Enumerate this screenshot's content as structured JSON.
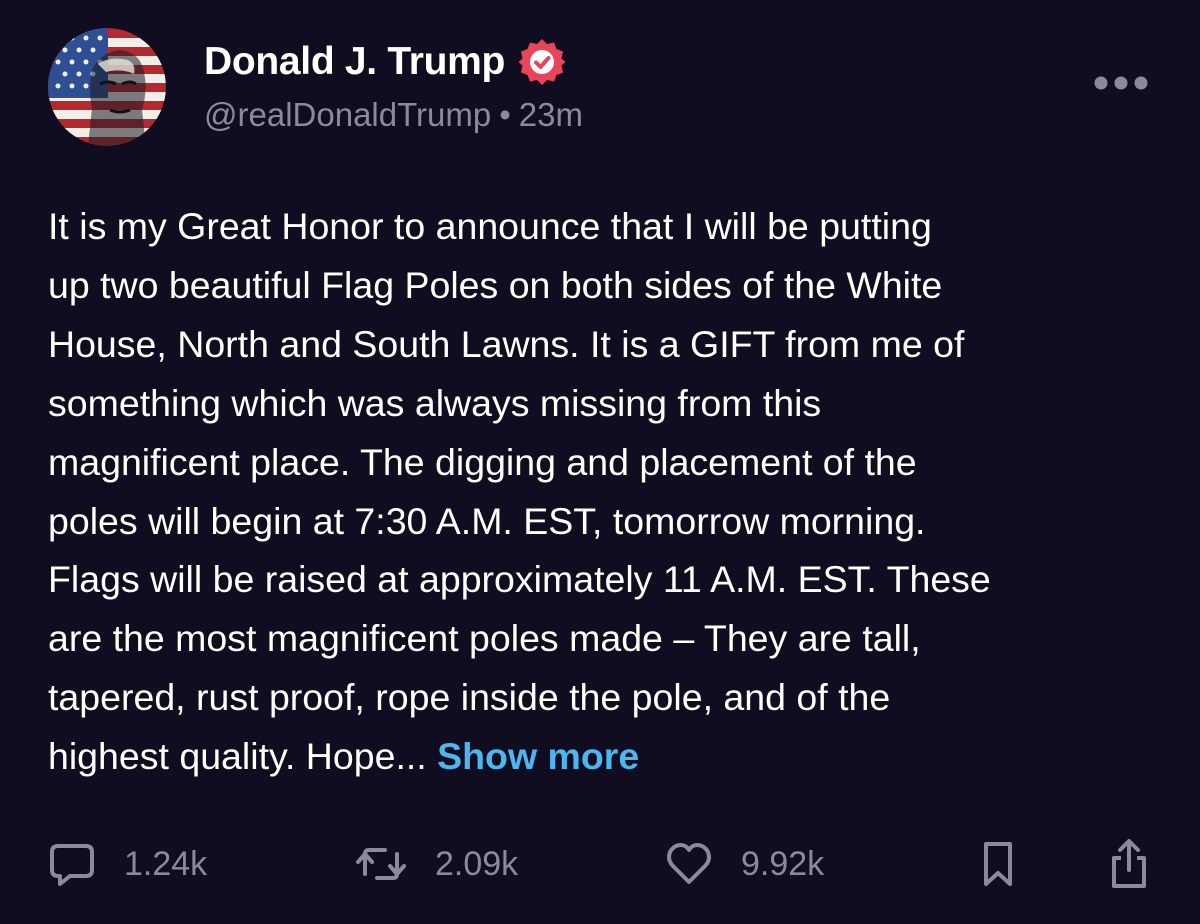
{
  "post": {
    "author": {
      "display_name": "Donald J. Trump",
      "handle": "@realDonaldTrump",
      "separator": "•",
      "timestamp": "23m",
      "verified_icon": "verified-badge-icon",
      "avatar_icon": "avatar-flag-portrait"
    },
    "more_icon": "more-horizontal-icon",
    "body_lines": [
      "It is my Great Honor to announce that I will be putting",
      "up two beautiful Flag Poles on both sides of the White",
      "House, North and South Lawns. It is a GIFT from me of",
      "something which was always missing from this",
      "magnificent place. The digging and placement of the",
      "poles will begin at 7:30 A.M. EST, tomorrow morning.",
      "Flags will be raised at approximately 11 A.M. EST. These",
      "are the most magnificent poles made – They are tall,",
      "tapered, rust proof, rope inside the pole, and of the",
      "highest quality. Hope... "
    ],
    "show_more_label": "Show more",
    "actions": {
      "replies": {
        "icon": "reply-icon",
        "count": "1.24k"
      },
      "retruths": {
        "icon": "retruth-icon",
        "count": "2.09k"
      },
      "likes": {
        "icon": "heart-icon",
        "count": "9.92k"
      },
      "bookmark": {
        "icon": "bookmark-icon"
      },
      "share": {
        "icon": "share-icon"
      }
    }
  },
  "colors": {
    "background": "#0f0d1f",
    "text": "#ffffff",
    "secondary_text": "#8b8a99",
    "link": "#4db5f0",
    "verified_badge": "#e8455a"
  }
}
